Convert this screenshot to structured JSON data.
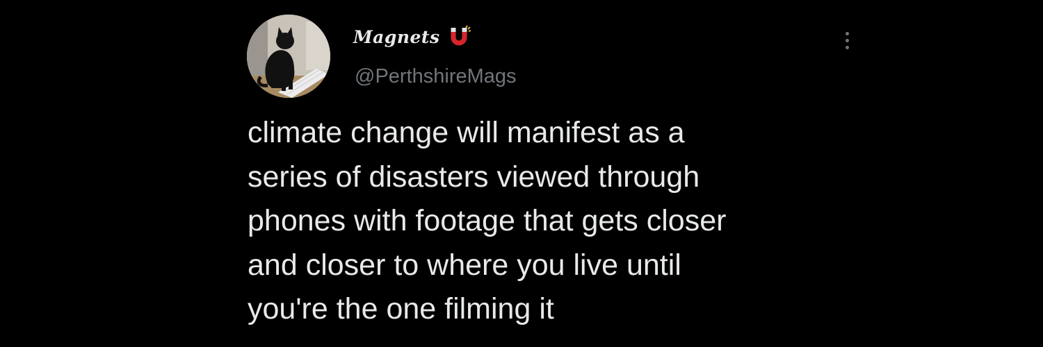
{
  "tweet": {
    "display_name": "Magnets",
    "handle": "@PerthshireMags",
    "text_lines": [
      "climate change will manifest as a",
      "series of disasters viewed through",
      "phones with footage that gets closer",
      "and closer to where you live until",
      "you're the one filming it"
    ]
  },
  "icons": {
    "badge": "magnet-icon",
    "menu": "more-options-icon",
    "avatar": "black-cat-photo"
  },
  "colors": {
    "background": "#000000",
    "primary_text": "#e7e9ea",
    "secondary_text": "#71767b",
    "magnet_red": "#d7262b"
  }
}
